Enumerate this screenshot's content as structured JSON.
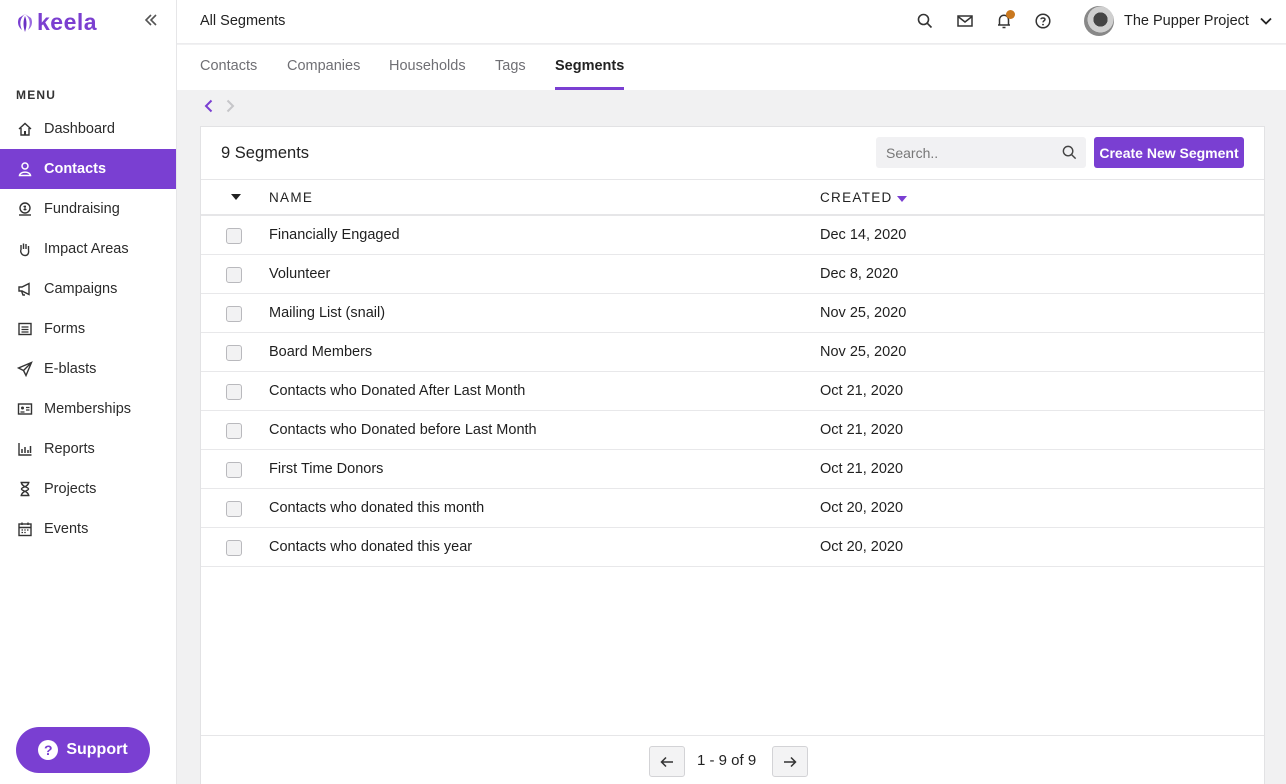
{
  "app": {
    "logo_text": "keela",
    "brand_color": "#7a3fd2"
  },
  "sidebar": {
    "menu_title": "MENU",
    "items": [
      {
        "label": "Dashboard",
        "icon": "home-icon"
      },
      {
        "label": "Contacts",
        "icon": "person-icon",
        "active": true
      },
      {
        "label": "Fundraising",
        "icon": "donation-icon"
      },
      {
        "label": "Impact Areas",
        "icon": "hand-icon"
      },
      {
        "label": "Campaigns",
        "icon": "megaphone-icon"
      },
      {
        "label": "Forms",
        "icon": "form-icon"
      },
      {
        "label": "E-blasts",
        "icon": "paper-plane-icon"
      },
      {
        "label": "Memberships",
        "icon": "id-card-icon"
      },
      {
        "label": "Reports",
        "icon": "bar-chart-icon"
      },
      {
        "label": "Projects",
        "icon": "hourglass-icon"
      },
      {
        "label": "Events",
        "icon": "calendar-icon"
      }
    ],
    "support_label": "Support"
  },
  "header": {
    "title": "All Segments",
    "profile_name": "The Pupper Project"
  },
  "tabs": [
    {
      "label": "Contacts"
    },
    {
      "label": "Companies"
    },
    {
      "label": "Households"
    },
    {
      "label": "Tags"
    },
    {
      "label": "Segments",
      "active": true
    }
  ],
  "segments": {
    "count_label": "9 Segments",
    "search_placeholder": "Search..",
    "create_label": "Create New Segment",
    "columns": {
      "name": "NAME",
      "created": "CREATED"
    },
    "rows": [
      {
        "name": "Financially Engaged",
        "created": "Dec 14, 2020"
      },
      {
        "name": "Volunteer",
        "created": "Dec 8, 2020"
      },
      {
        "name": "Mailing List (snail)",
        "created": "Nov 25, 2020"
      },
      {
        "name": "Board Members",
        "created": "Nov 25, 2020"
      },
      {
        "name": "Contacts who Donated After Last Month",
        "created": "Oct 21, 2020"
      },
      {
        "name": "Contacts who Donated before Last Month",
        "created": "Oct 21, 2020"
      },
      {
        "name": "First Time Donors",
        "created": "Oct 21, 2020"
      },
      {
        "name": "Contacts who donated this month",
        "created": "Oct 20, 2020"
      },
      {
        "name": "Contacts who donated this year",
        "created": "Oct 20, 2020"
      }
    ],
    "pagination": "1 - 9 of 9"
  }
}
